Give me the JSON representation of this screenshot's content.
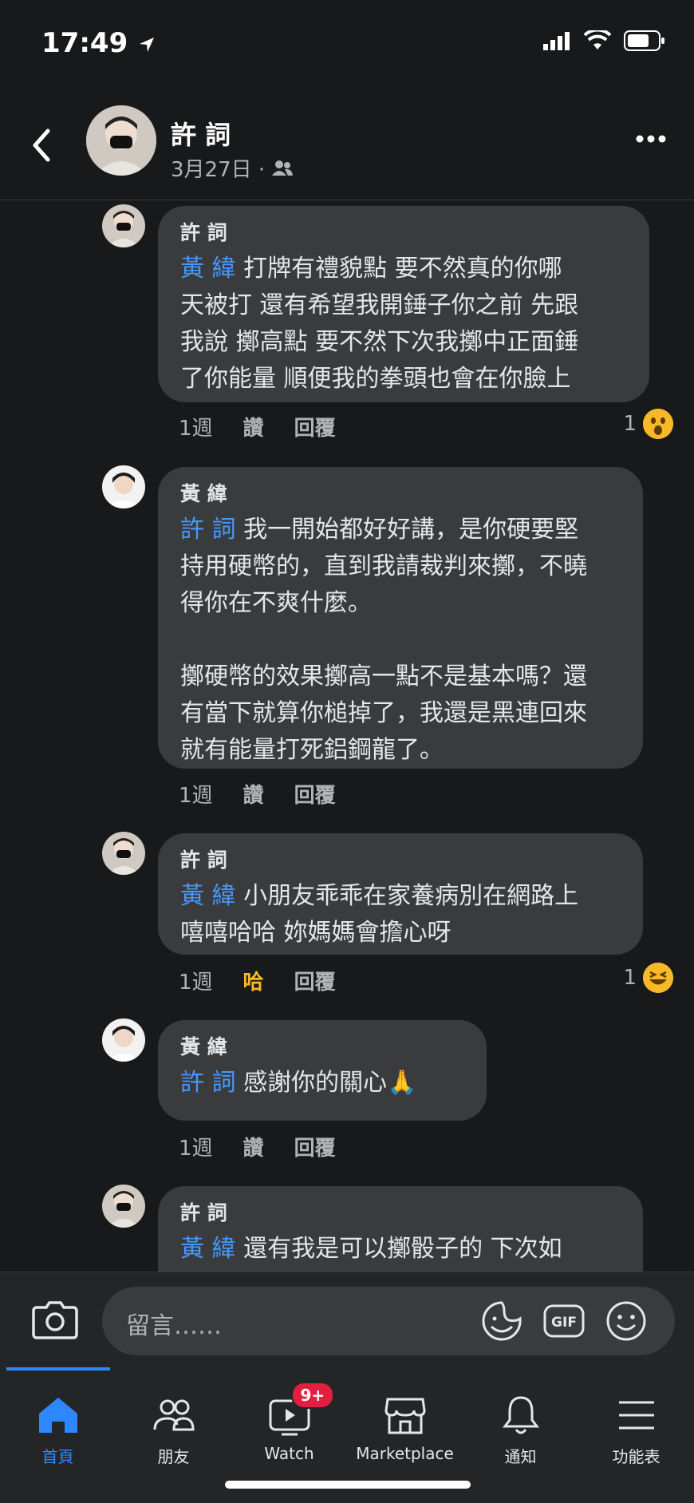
{
  "status": {
    "time": "17:49"
  },
  "header": {
    "name": "許 詞",
    "date": "3月27日 ·"
  },
  "comments": [
    {
      "author": "許 詞",
      "mention": "黃 緯",
      "text": " 打牌有禮貌點 要不然真的你哪\n天被打 還有希望我開錘子你之前 先跟\n我說 擲高點 要不然下次我擲中正面錘\n了你能量 順便我的拳頭也會在你臉上",
      "time": "1週",
      "like": "讚",
      "reply": "回覆",
      "reaction_count": "1",
      "reaction_icon": "wow-emoji"
    },
    {
      "author": "黃 緯",
      "mention": "許 詞",
      "text": " 我一開始都好好講，是你硬要堅\n持用硬幣的，直到我請裁判來擲，不曉\n得你在不爽什麼。\n\n擲硬幣的效果擲高一點不是基本嗎？還\n有當下就算你槌掉了，我還是黑連回來\n就有能量打死鋁鋼龍了。",
      "time": "1週",
      "like": "讚",
      "reply": "回覆"
    },
    {
      "author": "許 詞",
      "mention": "黃 緯",
      "text": " 小朋友乖乖在家養病別在網路上\n嘻嘻哈哈 妳媽媽會擔心呀",
      "time": "1週",
      "like": "哈",
      "reply": "回覆",
      "reaction_count": "1",
      "reaction_icon": "haha-emoji"
    },
    {
      "author": "黃 緯",
      "mention": "許 詞",
      "text": " 感謝你的關心🙏",
      "time": "1週",
      "like": "讚",
      "reply": "回覆"
    },
    {
      "author": "許 詞",
      "mention": "黃 緯",
      "text": " 還有我是可以擲骰子的 下次如"
    }
  ],
  "comment_input": {
    "placeholder": "留言……"
  },
  "tabs": [
    {
      "label": "首頁",
      "icon": "home-icon"
    },
    {
      "label": "朋友",
      "icon": "friends-icon"
    },
    {
      "label": "Watch",
      "icon": "watch-icon",
      "badge": "9+"
    },
    {
      "label": "Marketplace",
      "icon": "marketplace-icon"
    },
    {
      "label": "通知",
      "icon": "bell-icon"
    },
    {
      "label": "功能表",
      "icon": "menu-icon"
    }
  ],
  "colors": {
    "accent": "#2d88ff",
    "mention": "#4599ff",
    "bubble": "#3a3b3c",
    "background": "#18191a"
  }
}
